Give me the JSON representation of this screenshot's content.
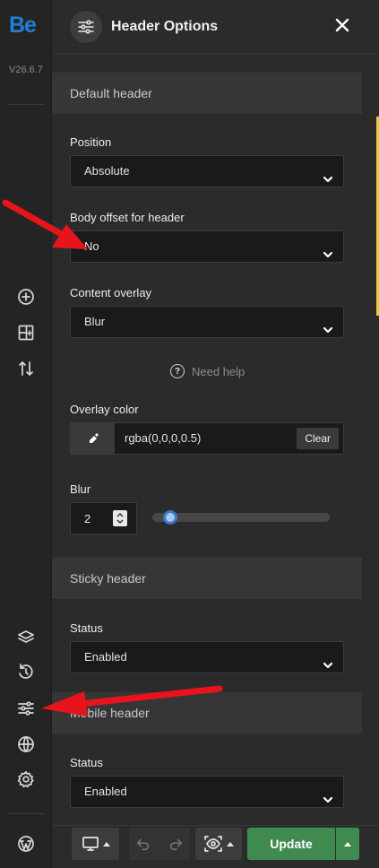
{
  "app": {
    "logo": "Be",
    "version": "V26.6.7"
  },
  "header": {
    "title": "Header Options",
    "icon": "sliders-icon",
    "close_icon": "close-icon"
  },
  "sections": {
    "default": {
      "title": "Default header",
      "position": {
        "label": "Position",
        "value": "Absolute"
      },
      "body_offset": {
        "label": "Body offset for header",
        "value": "No"
      },
      "content_overlay": {
        "label": "Content overlay",
        "value": "Blur"
      },
      "help": "Need help",
      "overlay_color": {
        "label": "Overlay color",
        "value": "rgba(0,0,0,0.5)",
        "clear": "Clear"
      },
      "blur": {
        "label": "Blur",
        "value": "2",
        "slider_fraction": 0.1
      }
    },
    "sticky": {
      "title": "Sticky header",
      "status_label": "Status",
      "status_value": "Enabled"
    },
    "mobile": {
      "title": "Mobile header",
      "status_label": "Status",
      "status_value": "Enabled"
    }
  },
  "footer": {
    "update": "Update"
  },
  "colors": {
    "accent_blue": "#1f7fd6",
    "update_green": "#3f8b4f",
    "arrow_red": "#e8141b",
    "slider_blue": "#3d76c5"
  },
  "rail_icons": [
    "plus-circle-icon",
    "layout-add-icon",
    "sort-arrows-icon",
    "layers-icon",
    "history-icon",
    "sliders-icon",
    "globe-icon",
    "gear-icon",
    "wordpress-icon"
  ]
}
